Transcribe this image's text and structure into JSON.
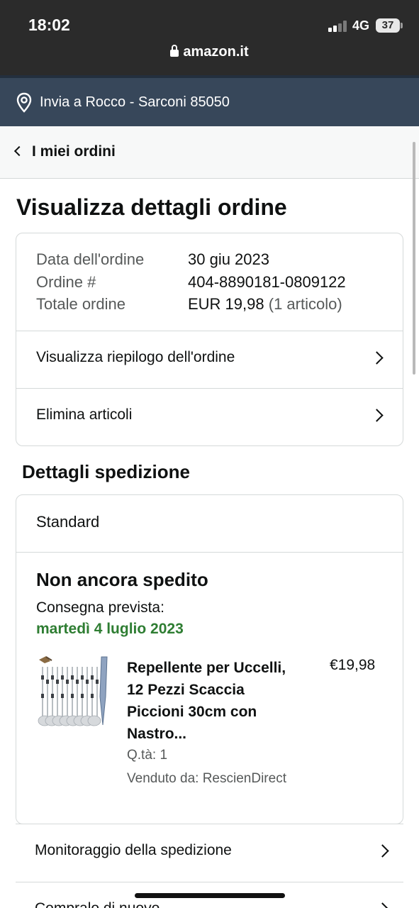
{
  "status_bar": {
    "time": "18:02",
    "network": "4G",
    "battery": "37"
  },
  "browser": {
    "url": "amazon.it"
  },
  "deliver_to": {
    "label": "Invia a Rocco - Sarconi 85050"
  },
  "nav": {
    "back_label": "I miei ordini"
  },
  "page": {
    "title": "Visualizza dettagli ordine"
  },
  "order": {
    "date_label": "Data dell'ordine",
    "date_value": "30 giu 2023",
    "number_label": "Ordine #",
    "number_value": "404-8890181-0809122",
    "total_label": "Totale ordine",
    "total_value": "EUR 19,98",
    "total_items": "(1 articolo)",
    "summary_link": "Visualizza riepilogo dell'ordine",
    "delete_link": "Elimina articoli"
  },
  "shipping": {
    "section_title": "Dettagli spedizione",
    "method": "Standard",
    "status": "Non ancora spedito",
    "delivery_label": "Consegna prevista:",
    "delivery_date": "martedì 4 luglio 2023",
    "status_color": "#2e7d32"
  },
  "product": {
    "title": "Repellente per Uccelli, 12 Pezzi Scaccia Piccioni 30cm con Nastro...",
    "price": "€19,98",
    "qty": "Q.tà: 1",
    "seller": "Venduto da: RescienDirect"
  },
  "links": {
    "tracking": "Monitoraggio della spedizione",
    "buy_again": "Compralo di nuovo"
  }
}
